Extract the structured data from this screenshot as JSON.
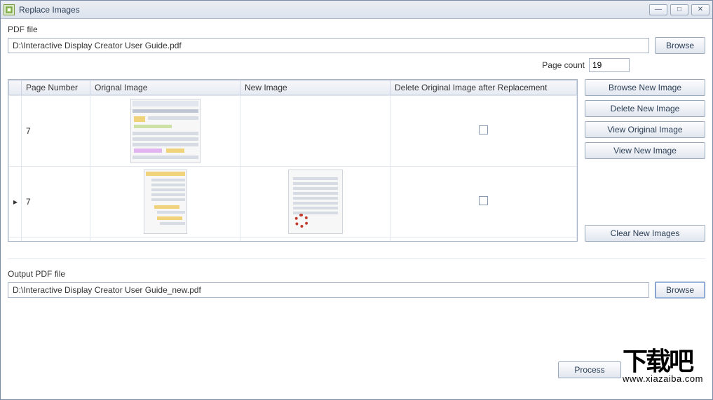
{
  "window": {
    "title": "Replace Images"
  },
  "pdf": {
    "label": "PDF file",
    "path": "D:\\Interactive Display Creator User Guide.pdf",
    "browse": "Browse",
    "page_count_label": "Page count",
    "page_count": "19"
  },
  "grid": {
    "headers": {
      "page_number": "Page Number",
      "original_image": "Orignal Image",
      "new_image": "New Image",
      "delete_after": "Delete Original Image after Replacement"
    },
    "rows": [
      {
        "indicator": "",
        "page": "7",
        "has_new": false,
        "delete": false
      },
      {
        "indicator": "▸",
        "page": "7",
        "has_new": true,
        "delete": false
      }
    ]
  },
  "side": {
    "browse_new": "Browse New Image",
    "delete_new": "Delete New Image",
    "view_original": "View Original Image",
    "view_new": "View New Image",
    "clear_new": "Clear New Images"
  },
  "output": {
    "label": "Output PDF file",
    "path": "D:\\Interactive Display Creator User Guide_new.pdf",
    "browse": "Browse"
  },
  "process": "Process",
  "watermark": {
    "big": "下载吧",
    "sub": "www.xiazaiba.com"
  }
}
